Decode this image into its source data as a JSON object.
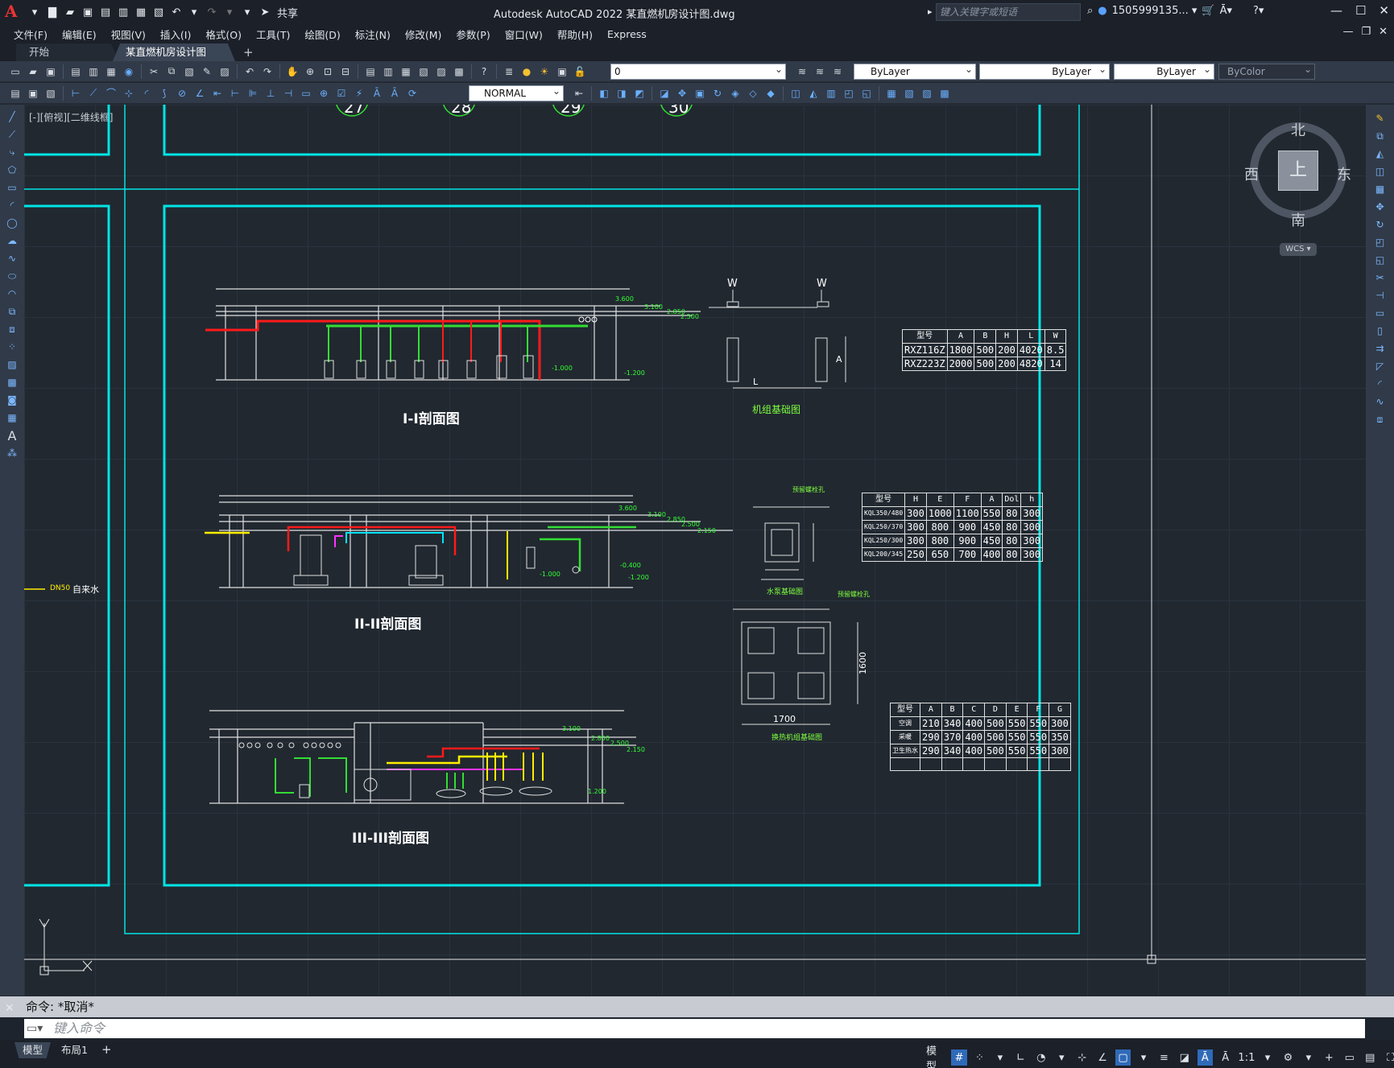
{
  "app": {
    "window_title": "Autodesk AutoCAD 2022    某直燃机房设计图.dwg",
    "share_label": "共享",
    "search_placeholder": "键入关键字或短语",
    "user": "1505999135... ▾"
  },
  "menu": [
    "文件(F)",
    "编辑(E)",
    "视图(V)",
    "插入(I)",
    "格式(O)",
    "工具(T)",
    "绘图(D)",
    "标注(N)",
    "修改(M)",
    "参数(P)",
    "窗口(W)",
    "帮助(H)",
    "Express"
  ],
  "tabs": [
    {
      "label": "开始"
    },
    {
      "label": "某直燃机房设计图*"
    }
  ],
  "toolbar": {
    "layer_value": "0",
    "color_value": "ByLayer",
    "linetype_value": "ByLayer",
    "lineweight_value": "ByLayer",
    "plotstyle_value": "ByColor",
    "textstyle_value": "NORMAL"
  },
  "viewport": {
    "view_label": "[-][俯视][二维线框]",
    "compass": {
      "north": "北",
      "south": "南",
      "east": "东",
      "west": "西",
      "top": "上",
      "wcs": "WCS"
    },
    "bubbles": [
      "27",
      "28",
      "29",
      "30"
    ],
    "side_label_dn": "DN50",
    "side_label_water": "自来水"
  },
  "drawing": {
    "section1_title": "I-I剖面图",
    "section2_title": "II-II剖面图",
    "section3_title": "III-III剖面图",
    "fdn1_title": "机组基础图",
    "fdn2_title": "水泵基础图",
    "fdn3_title": "换热机组基础图",
    "fdn2_note": "预留螺栓孔",
    "fdn3_note": "预留螺栓孔",
    "fdn1_dim_L": "L",
    "fdn1_dim_A": "A",
    "fdn1_dim_W": "W",
    "fdn3_dim_1700": "1700",
    "fdn3_dim_1600": "1600",
    "elev_labels": [
      "3.600",
      "3.100",
      "2.850",
      "2.500",
      "-1.000",
      "-1.200",
      "3.600",
      "3.100",
      "2.850",
      "2.500",
      "2.150",
      "-0.400",
      "-1.000",
      "-1.200",
      "3.100",
      "2.850",
      "2.500",
      "2.150",
      "1.200"
    ],
    "table1": {
      "headers": [
        "型号",
        "A",
        "B",
        "H",
        "L",
        "W"
      ],
      "rows": [
        [
          "RXZ116Z",
          "1800",
          "500",
          "200",
          "4020",
          "8.5"
        ],
        [
          "RXZ223Z",
          "2000",
          "500",
          "200",
          "4820",
          "14"
        ]
      ]
    },
    "table2": {
      "headers": [
        "型号",
        "H",
        "E",
        "F",
        "A",
        "Dol",
        "h"
      ],
      "rows": [
        [
          "KQL350/480",
          "300",
          "1000",
          "1100",
          "550",
          "80",
          "300"
        ],
        [
          "KQL250/370",
          "300",
          "800",
          "900",
          "450",
          "80",
          "300"
        ],
        [
          "KQL250/300",
          "300",
          "800",
          "900",
          "450",
          "80",
          "300"
        ],
        [
          "KQL200/345",
          "250",
          "650",
          "700",
          "400",
          "80",
          "300"
        ]
      ]
    },
    "table3": {
      "headers": [
        "型号",
        "A",
        "B",
        "C",
        "D",
        "E",
        "F",
        "G"
      ],
      "rows": [
        [
          "空调",
          "210",
          "340",
          "400",
          "500",
          "550",
          "550",
          "300"
        ],
        [
          "采暖",
          "290",
          "370",
          "400",
          "500",
          "550",
          "550",
          "350"
        ],
        [
          "卫生热水",
          "290",
          "340",
          "400",
          "500",
          "550",
          "550",
          "300"
        ],
        [
          "",
          "",
          "",
          "",
          "",
          "",
          "",
          ""
        ]
      ]
    }
  },
  "command": {
    "history": "命令: *取消*",
    "placeholder": "键入命令"
  },
  "status": {
    "model_tab": "模型",
    "layout_tab": "布局1",
    "model_label": "模型",
    "scale": "1:1"
  },
  "colors": {
    "cyan_frame": "#00e5e5",
    "pipe_red": "#ff1a1a",
    "pipe_green": "#33dd33",
    "pipe_yellow": "#ffee00",
    "pipe_magenta": "#ff33ff",
    "pipe_cyan": "#00e5ff"
  }
}
